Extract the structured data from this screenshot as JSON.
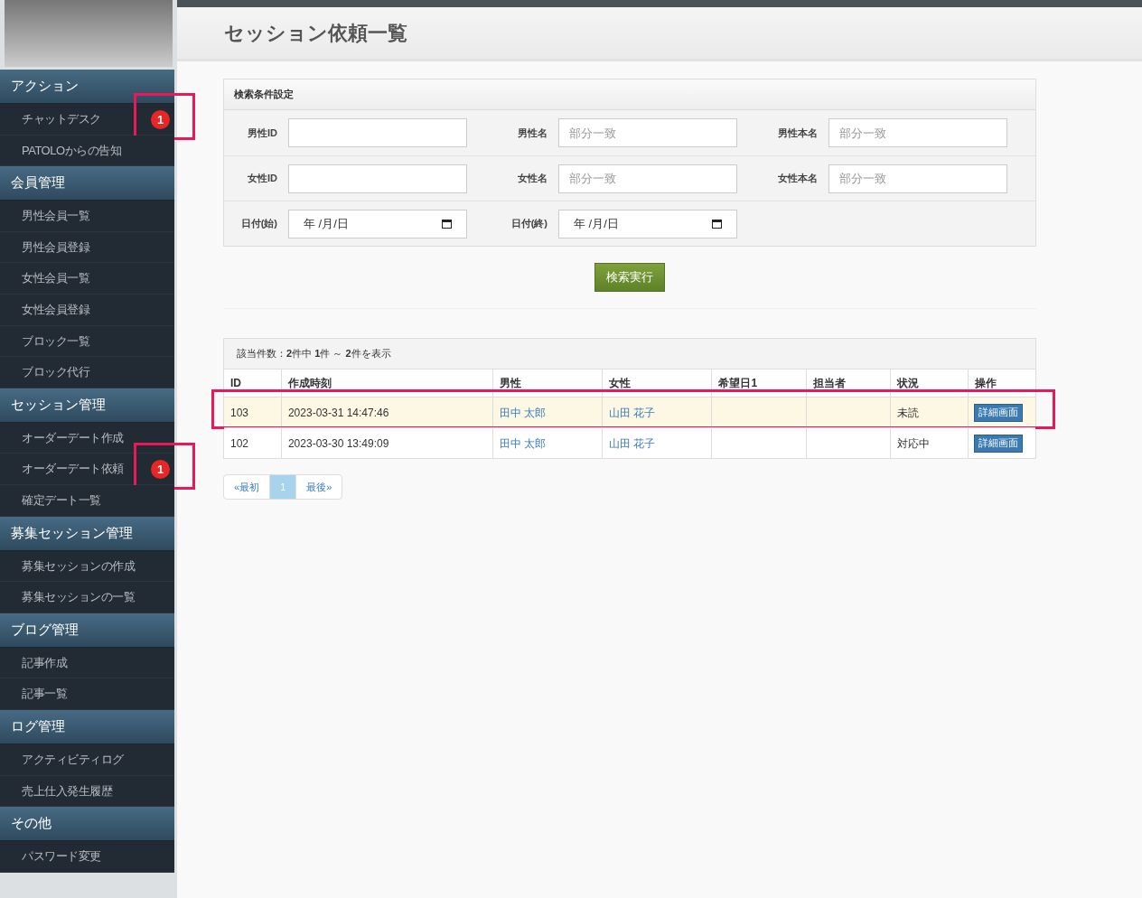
{
  "sidebar": {
    "sections": [
      {
        "title": "アクション",
        "items": [
          {
            "label": "チャットデスク",
            "badge": "1",
            "highlighted": true
          },
          {
            "label": "PATOLOからの告知",
            "highlighted": false
          }
        ]
      },
      {
        "title": "会員管理",
        "items": [
          {
            "label": "男性会員一覧",
            "highlighted": false
          },
          {
            "label": "男性会員登録",
            "highlighted": false
          },
          {
            "label": "女性会員一覧",
            "highlighted": false
          },
          {
            "label": "女性会員登録",
            "highlighted": false
          },
          {
            "label": "ブロック一覧",
            "highlighted": false
          },
          {
            "label": "ブロック代行",
            "highlighted": false
          }
        ]
      },
      {
        "title": "セッション管理",
        "items": [
          {
            "label": "オーダーデート作成",
            "highlighted": false
          },
          {
            "label": "オーダーデート依頼",
            "badge": "1",
            "highlighted": true
          },
          {
            "label": "確定デート一覧",
            "highlighted": false
          }
        ]
      },
      {
        "title": "募集セッション管理",
        "items": [
          {
            "label": "募集セッションの作成",
            "highlighted": false
          },
          {
            "label": "募集セッションの一覧",
            "highlighted": false
          }
        ]
      },
      {
        "title": "ブログ管理",
        "items": [
          {
            "label": "記事作成",
            "highlighted": false
          },
          {
            "label": "記事一覧",
            "highlighted": false
          }
        ]
      },
      {
        "title": "ログ管理",
        "items": [
          {
            "label": "アクティビティログ",
            "highlighted": false
          },
          {
            "label": "売上仕入発生履歴",
            "highlighted": false
          }
        ]
      },
      {
        "title": "その他",
        "items": [
          {
            "label": "パスワード変更",
            "highlighted": false
          }
        ]
      }
    ]
  },
  "page_title": "セッション依頼一覧",
  "search": {
    "title": "検索条件設定",
    "rows": [
      [
        {
          "label": "男性ID",
          "kind": "text"
        },
        {
          "label": "男性名",
          "kind": "text",
          "placeholder": "部分一致"
        },
        {
          "label": "男性本名",
          "kind": "text",
          "placeholder": "部分一致"
        }
      ],
      [
        {
          "label": "女性ID",
          "kind": "text"
        },
        {
          "label": "女性名",
          "kind": "text",
          "placeholder": "部分一致"
        },
        {
          "label": "女性本名",
          "kind": "text",
          "placeholder": "部分一致"
        }
      ],
      [
        {
          "label": "日付(始)",
          "kind": "date",
          "value": "年 /月/日"
        },
        {
          "label": "日付(終)",
          "kind": "date",
          "value": "年 /月/日"
        }
      ]
    ],
    "button": "検索実行"
  },
  "results": {
    "summary": "該当件数：**2**件中 **1**件 ～ **2**件を表示",
    "columns": [
      "ID",
      "作成時刻",
      "男性",
      "女性",
      "希望日1",
      "担当者",
      "状況",
      "操作"
    ],
    "rows": [
      {
        "id": "103",
        "created": "2023-03-31 14:47:46",
        "male": "田中 太郎",
        "female": "山田 花子",
        "status": "未読",
        "action": "詳細画面",
        "unread": true,
        "highlighted": true
      },
      {
        "id": "102",
        "created": "2023-03-30 13:49:09",
        "male": "田中 太郎",
        "female": "山田 花子",
        "status": "対応中",
        "action": "詳細画面",
        "unread": false,
        "highlighted": false
      }
    ]
  },
  "pagination": [
    {
      "label": "«最初",
      "selected": false
    },
    {
      "label": "1",
      "selected": true
    },
    {
      "label": "最後»",
      "selected": false
    }
  ]
}
